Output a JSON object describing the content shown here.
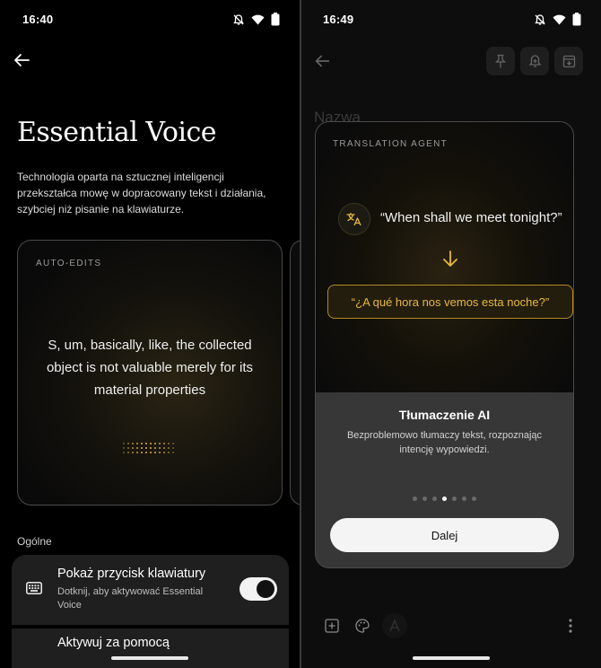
{
  "left": {
    "status": {
      "time": "16:40"
    },
    "title": "Essential Voice",
    "description": "Technologia oparta na sztucznej inteligencji przekształca mowę w dopracowany tekst i działania, szybciej niż pisanie na klawiaturze.",
    "card": {
      "label": "AUTO-EDITS",
      "text": "S, um, basically, like, the collected object is not valuable merely for its material properties"
    },
    "section_label": "Ogólne",
    "settings": [
      {
        "title": "Pokaż przycisk klawiatury",
        "subtitle": "Dotknij, aby aktywować Essential Voice",
        "toggle_on": true
      },
      {
        "title": "Aktywuj za pomocą"
      }
    ],
    "icons": {
      "back": "arrow-left-icon",
      "keyboard": "keyboard-icon",
      "mute": "bell-off-icon",
      "wifi": "wifi-icon",
      "battery": "battery-icon"
    }
  },
  "right": {
    "status": {
      "time": "16:49"
    },
    "note_title_placeholder": "Nazwa",
    "modal": {
      "label": "TRANSLATION AGENT",
      "source_quote": "“When shall we meet tonight?”",
      "translated": "“¿A qué hora nos vemos esta noche?”",
      "title": "Tłumaczenie AI",
      "description": "Bezproblemowo tłumaczy tekst, rozpoznając intencję wypowiedzi.",
      "pages": 7,
      "active_page": 4,
      "button": "Dalej"
    },
    "icons": {
      "pin": "pin-icon",
      "reminder": "bell-plus-icon",
      "archive": "archive-icon",
      "add": "add-box-icon",
      "palette": "palette-icon",
      "text_format": "text-format-icon",
      "more": "more-vert-icon",
      "translate": "translate-icon",
      "arrow_down": "arrow-down-icon"
    },
    "accent": "#e6b93e"
  }
}
